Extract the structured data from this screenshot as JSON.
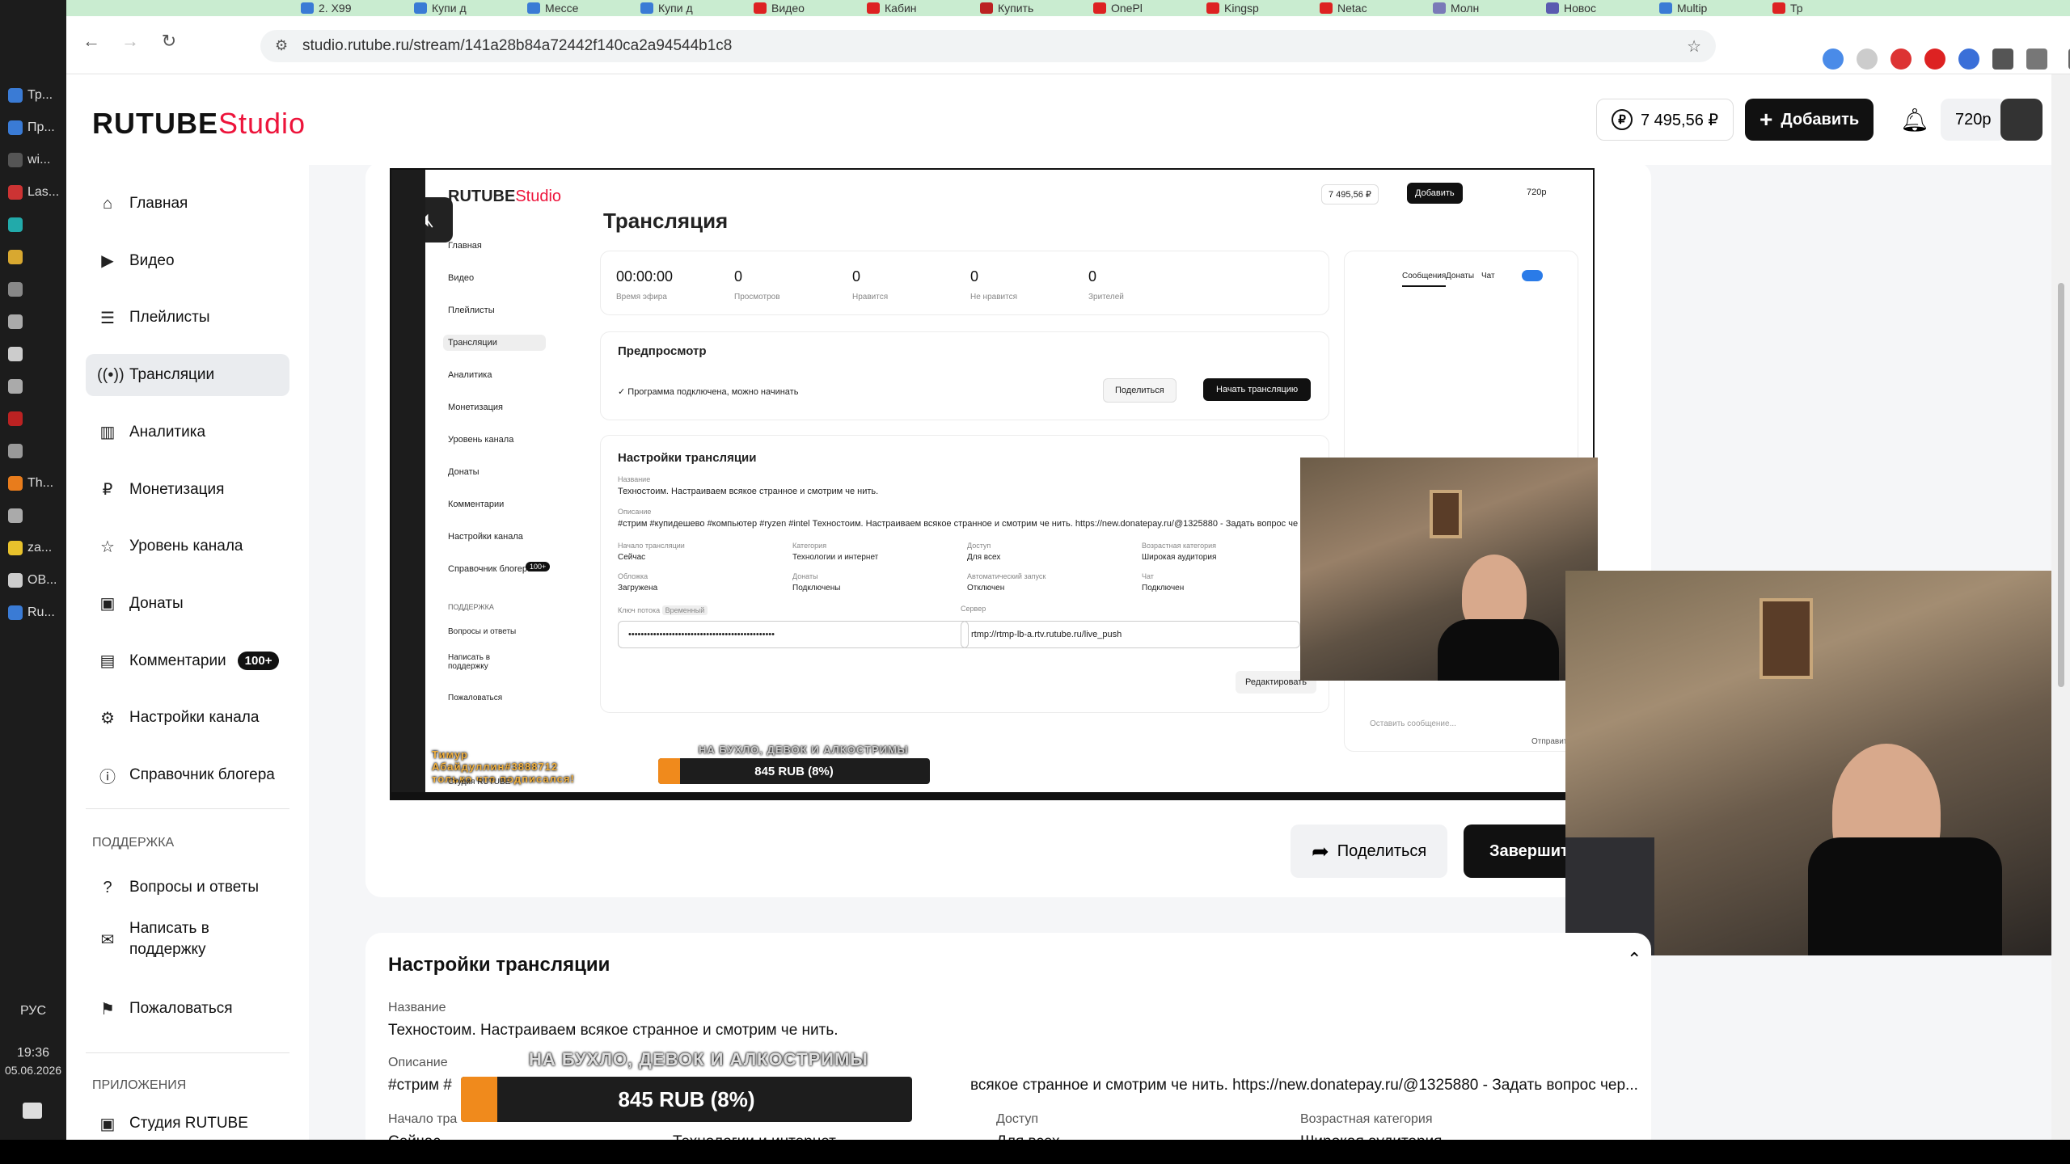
{
  "os": {
    "items": [
      "Тр...",
      "Пр...",
      "wi...",
      "Las...",
      "",
      "",
      "",
      "",
      "",
      "",
      "",
      "",
      "Th...",
      "",
      "za...",
      "OB...",
      "Ru..."
    ],
    "lang": "РУС",
    "time": "19:36",
    "date": "05.06.2026"
  },
  "browser": {
    "tabs": [
      "2. X99",
      "Купи д",
      "Мессе",
      "Купи д",
      "Видео",
      "Кабин",
      "Купить",
      "OnePl",
      "Kingsp",
      "Netac",
      "Молн",
      "Новос",
      "Multip",
      "Тр"
    ],
    "url": "studio.rutube.ru/stream/141a28b84a72442f140ca2a94544b1c8"
  },
  "header": {
    "logo_main": "RUTUBE",
    "logo_studio": "Studio",
    "balance": "7 495,56 ₽",
    "add_label": "Добавить",
    "quality": "720p"
  },
  "sidebar": {
    "items": [
      {
        "label": "Главная"
      },
      {
        "label": "Видео"
      },
      {
        "label": "Плейлисты"
      },
      {
        "label": "Трансляции"
      },
      {
        "label": "Аналитика"
      },
      {
        "label": "Монетизация"
      },
      {
        "label": "Уровень канала"
      },
      {
        "label": "Донаты"
      },
      {
        "label": "Комментарии",
        "badge": "100+"
      },
      {
        "label": "Настройки канала"
      },
      {
        "label": "Справочник блогера"
      }
    ],
    "support_heading": "ПОДДЕРЖКА",
    "support_items": [
      "Вопросы и ответы",
      "Написать в поддержку",
      "Пожаловаться"
    ],
    "apps_heading": "ПРИЛОЖЕНИЯ",
    "apps_items": [
      "Студия RUTUBE"
    ]
  },
  "preview": {
    "title": "Трансляция",
    "stats": [
      {
        "value": "00:00:00",
        "label": "Время эфира"
      },
      {
        "value": "0",
        "label": "Просмотров"
      },
      {
        "value": "0",
        "label": "Нравится"
      },
      {
        "value": "0",
        "label": "Не нравится"
      },
      {
        "value": "0",
        "label": "Зрителей"
      }
    ],
    "preview_heading": "Предпросмотр",
    "connected": "Программа подключена, можно начинать",
    "share": "Поделиться",
    "start": "Начать трансляцию",
    "settings_heading": "Настройки трансляции",
    "name_label": "Название",
    "name": "Техностоим. Настраиваем всякое странное и смотрим че нить.",
    "desc_label": "Описание",
    "desc": "#стрим #купидешево #компьютер #ryzen #intel Техностоим. Настраиваем всякое странное и смотрим че нить. https://new.donatepay.ru/@1325880 - Задать вопрос че",
    "start_label": "Начало трансляции",
    "start_val": "Сейчас",
    "cat_label": "Категория",
    "cat_val": "Технологии и интернет",
    "access_label": "Доступ",
    "access_val": "Для всех",
    "age_label": "Возрастная категория",
    "age_val": "Широкая аудитория",
    "cover_label": "Обложка",
    "cover_val": "Загружена",
    "donates_label": "Донаты",
    "donates_val": "Подключены",
    "auto_label": "Автоматический запуск",
    "auto_val": "Отключен",
    "chat_label": "Чат",
    "chat_val": "Подключен",
    "key_label": "Ключ потока",
    "key_badge": "Временный",
    "server_label": "Сервер",
    "server_val": "rtmp://rtmp-lb-a.rtv.rutube.ru/live_push",
    "edit": "Редактировать",
    "chat_tabs": [
      "Сообщения",
      "Донаты",
      "Чат"
    ],
    "chat_placeholder": "Оставить сообщение...",
    "send": "Отправить",
    "sidebar": [
      "Главная",
      "Видео",
      "Плейлисты",
      "Трансляции",
      "Аналитика",
      "Монетизация",
      "Уровень канала",
      "Донаты",
      "Комментарии",
      "Настройки канала",
      "Справочник блогера"
    ],
    "sidebar_support": "ПОДДЕРЖКА",
    "sidebar_support_items": [
      "Вопросы и ответы",
      "Написать в поддержку",
      "Пожаловаться"
    ],
    "sidebar_app": "Студия RUTUBE",
    "sidebar_badge": "100+",
    "alert": "Тимур Абайдуллин#3888712 только что подписался!",
    "donation_title": "НА БУХЛО, ДЕВОК И АЛКОСТРИМЫ",
    "donation_amount": "845 RUB (8%)",
    "donation_progress": 0.08,
    "balance": "7 495,56 ₽",
    "add": "Добавить",
    "quality": "720p"
  },
  "actions": {
    "share": "Поделиться",
    "finish": "Завершить"
  },
  "settings": {
    "heading": "Настройки трансляции",
    "name_label": "Название",
    "name": "Техностоим. Настраиваем всякое странное и смотрим че нить.",
    "desc_label": "Описание",
    "desc_start": "#стрим #",
    "desc_end": "всякое странное и смотрим че нить. https://new.donatepay.ru/@1325880 - Задать вопрос чер...",
    "start_label": "Начало тра",
    "start_val": "Сейчас",
    "cat_val": "Технологии и интернет",
    "access_label": "Доступ",
    "access_val": "Для всех",
    "age_label": "Возрастная категория",
    "age_val": "Широкая аудитория"
  },
  "donation_overlay": {
    "title": "НА БУХЛО, ДЕВОК И АЛКОСТРИМЫ",
    "amount": "845 RUB (8%)",
    "progress": 0.08
  },
  "colors": {
    "accent": "#ed143b",
    "donation_fill": "#f08a1c",
    "dark_button": "#111111"
  }
}
